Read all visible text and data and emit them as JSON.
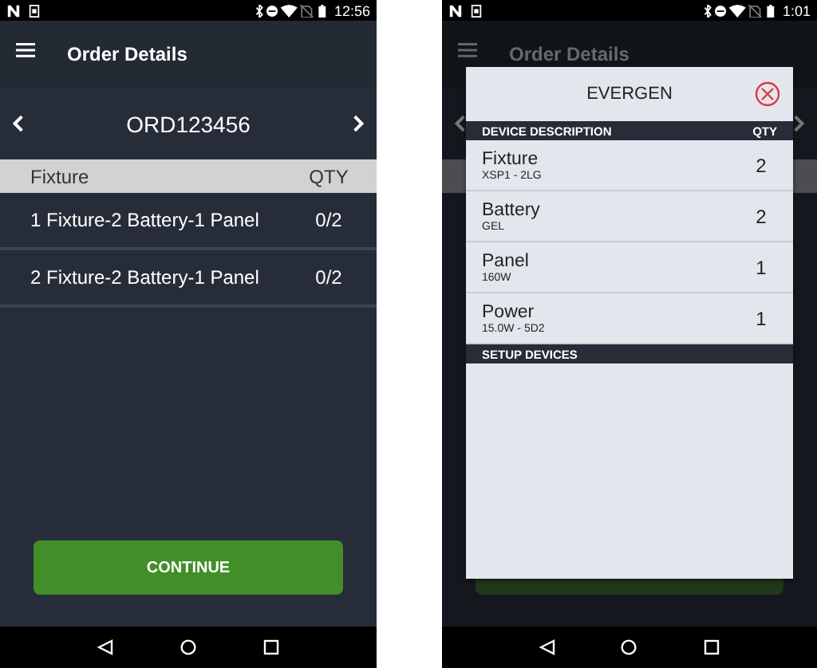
{
  "order_screen": {
    "status_time": "12:56",
    "title": "Order Details",
    "order_number": "ORD123456",
    "table": {
      "columns": [
        "Fixture",
        "QTY"
      ],
      "rows": [
        {
          "description": "1 Fixture-2 Battery-1 Panel",
          "qty": "0/2"
        },
        {
          "description": "2 Fixture-2 Battery-1 Panel",
          "qty": "0/2"
        }
      ]
    },
    "continue_button": "CONTINUE"
  },
  "dialog_screen": {
    "status_time": "1:01",
    "background_title": "Order Details",
    "dialog": {
      "title": "EVERGEN",
      "columns": [
        "DEVICE DESCRIPTION",
        "QTY"
      ],
      "devices": [
        {
          "name": "Fixture",
          "detail": "XSP1 - 2LG",
          "qty": "2"
        },
        {
          "name": "Battery",
          "detail": "GEL",
          "qty": "2"
        },
        {
          "name": "Panel",
          "detail": "160W",
          "qty": "1"
        },
        {
          "name": "Power",
          "detail": "15.0W - 5D2",
          "qty": "1"
        }
      ],
      "setup_section": "SETUP DEVICES"
    }
  }
}
